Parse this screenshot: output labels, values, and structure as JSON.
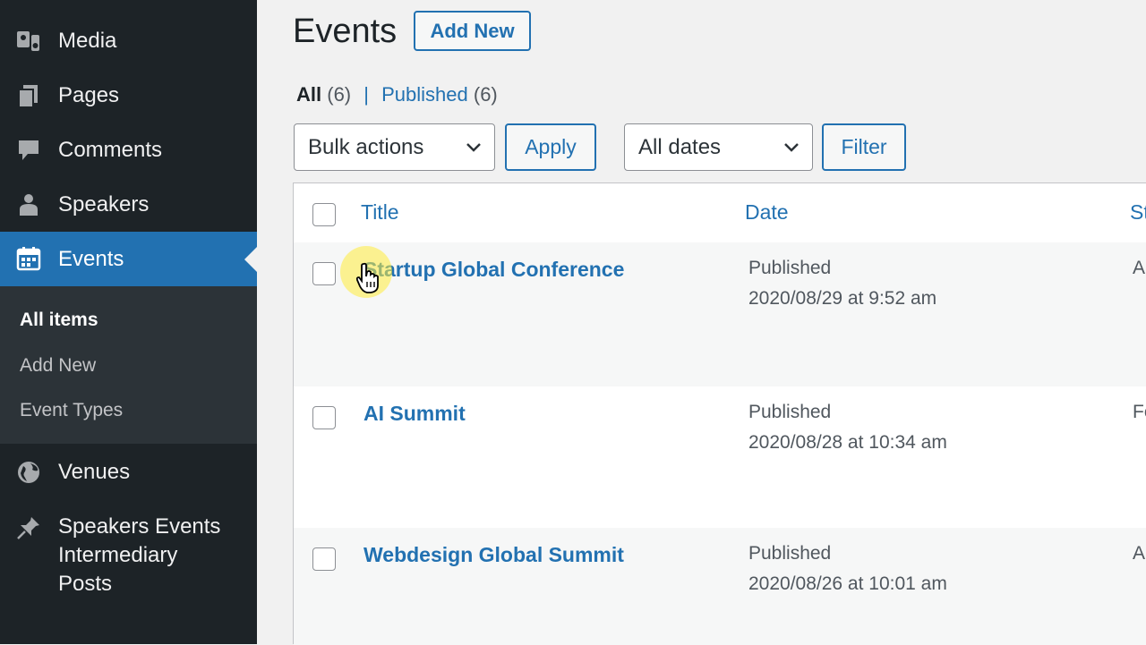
{
  "sidebar": {
    "items": [
      {
        "label": "Media",
        "icon": "media-icon"
      },
      {
        "label": "Pages",
        "icon": "pages-icon"
      },
      {
        "label": "Comments",
        "icon": "comments-icon"
      },
      {
        "label": "Speakers",
        "icon": "user-icon"
      },
      {
        "label": "Events",
        "icon": "calendar-icon",
        "active": true
      },
      {
        "label": "Venues",
        "icon": "globe-icon"
      },
      {
        "label": "Speakers Events Intermediary Posts",
        "label_lines": [
          "Speakers Events",
          "Intermediary",
          "Posts"
        ],
        "icon": "pin-icon"
      }
    ],
    "submenu": [
      {
        "label": "All items",
        "current": true
      },
      {
        "label": "Add New"
      },
      {
        "label": "Event Types"
      }
    ]
  },
  "header": {
    "title": "Events",
    "add_new_label": "Add New"
  },
  "views": {
    "all_label": "All",
    "all_count": "(6)",
    "separator": "|",
    "published_label": "Published",
    "published_count": "(6)"
  },
  "filters": {
    "bulk_actions": "Bulk actions",
    "apply_label": "Apply",
    "dates": "All dates",
    "filter_label": "Filter"
  },
  "table": {
    "columns": [
      "Title",
      "Date",
      "St"
    ],
    "rows": [
      {
        "title": "Startup Global Conference",
        "status": "Published",
        "date": "2020/08/29 at 9:52 am",
        "trunc": "A"
      },
      {
        "title": "AI Summit",
        "status": "Published",
        "date": "2020/08/28 at 10:34 am",
        "trunc": "Fe"
      },
      {
        "title": "Webdesign Global Summit",
        "status": "Published",
        "date": "2020/08/26 at 10:01 am",
        "trunc": "A"
      }
    ]
  },
  "colors": {
    "sidebar_bg": "#1d2327",
    "accent": "#2271b1",
    "submenu_bg": "#2c3338"
  }
}
